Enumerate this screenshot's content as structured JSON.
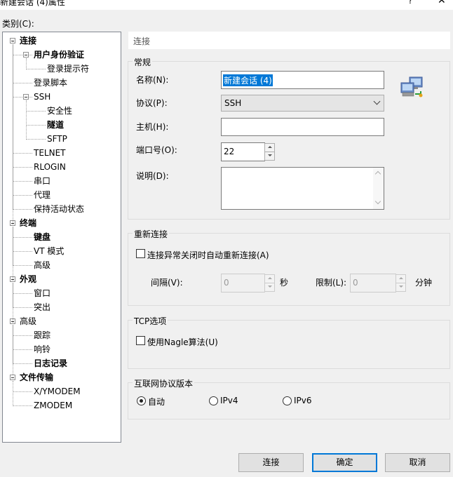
{
  "window": {
    "title": "新建会话 (4)属性",
    "help_glyph": "?",
    "close_glyph": "✕"
  },
  "category_label": "类别(C):",
  "tree": {
    "items": [
      {
        "label": "连接",
        "level": 0,
        "bold": true,
        "expanded": true
      },
      {
        "label": "用户身份验证",
        "level": 1,
        "bold": true,
        "expanded": true
      },
      {
        "label": "登录提示符",
        "level": 2,
        "bold": false
      },
      {
        "label": "登录脚本",
        "level": 1,
        "bold": false
      },
      {
        "label": "SSH",
        "level": 1,
        "bold": false,
        "expanded": true
      },
      {
        "label": "安全性",
        "level": 2,
        "bold": false
      },
      {
        "label": "隧道",
        "level": 2,
        "bold": true
      },
      {
        "label": "SFTP",
        "level": 2,
        "bold": false
      },
      {
        "label": "TELNET",
        "level": 1,
        "bold": false
      },
      {
        "label": "RLOGIN",
        "level": 1,
        "bold": false
      },
      {
        "label": "串口",
        "level": 1,
        "bold": false
      },
      {
        "label": "代理",
        "level": 1,
        "bold": false
      },
      {
        "label": "保持活动状态",
        "level": 1,
        "bold": false
      },
      {
        "label": "终端",
        "level": 0,
        "bold": true,
        "expanded": true
      },
      {
        "label": "键盘",
        "level": 1,
        "bold": true
      },
      {
        "label": "VT 模式",
        "level": 1,
        "bold": false
      },
      {
        "label": "高级",
        "level": 1,
        "bold": false
      },
      {
        "label": "外观",
        "level": 0,
        "bold": true,
        "expanded": true
      },
      {
        "label": "窗口",
        "level": 1,
        "bold": false
      },
      {
        "label": "突出",
        "level": 1,
        "bold": false
      },
      {
        "label": "高级",
        "level": 0,
        "bold": false,
        "expanded": true
      },
      {
        "label": "跟踪",
        "level": 1,
        "bold": false
      },
      {
        "label": "响铃",
        "level": 1,
        "bold": false
      },
      {
        "label": "日志记录",
        "level": 1,
        "bold": true
      },
      {
        "label": "文件传输",
        "level": 0,
        "bold": true,
        "expanded": true
      },
      {
        "label": "X/YMODEM",
        "level": 1,
        "bold": false
      },
      {
        "label": "ZMODEM",
        "level": 1,
        "bold": false
      }
    ]
  },
  "panel": {
    "header": "连接",
    "general": {
      "title": "常规",
      "name_label": "名称(N):",
      "name_value": "新建会话 (4)",
      "protocol_label": "协议(P):",
      "protocol_value": "SSH",
      "host_label": "主机(H):",
      "host_value": "",
      "port_label": "端口号(O):",
      "port_value": "22",
      "desc_label": "说明(D):",
      "desc_value": ""
    },
    "reconnect": {
      "title": "重新连接",
      "checkbox_label": "连接异常关闭时自动重新连接(A)",
      "interval_label": "间隔(V):",
      "interval_value": "0",
      "interval_unit": "秒",
      "limit_label": "限制(L):",
      "limit_value": "0",
      "limit_unit": "分钟"
    },
    "tcp": {
      "title": "TCP选项",
      "nagle_label": "使用Nagle算法(U)"
    },
    "ip_version": {
      "title": "互联网协议版本",
      "options": [
        "自动",
        "IPv4",
        "IPv6"
      ],
      "selected": "自动"
    }
  },
  "buttons": {
    "connect": "连接",
    "ok": "确定",
    "cancel": "取消"
  },
  "colors": {
    "accent": "#0078d7",
    "dialog_bg": "#f0f0f0"
  }
}
